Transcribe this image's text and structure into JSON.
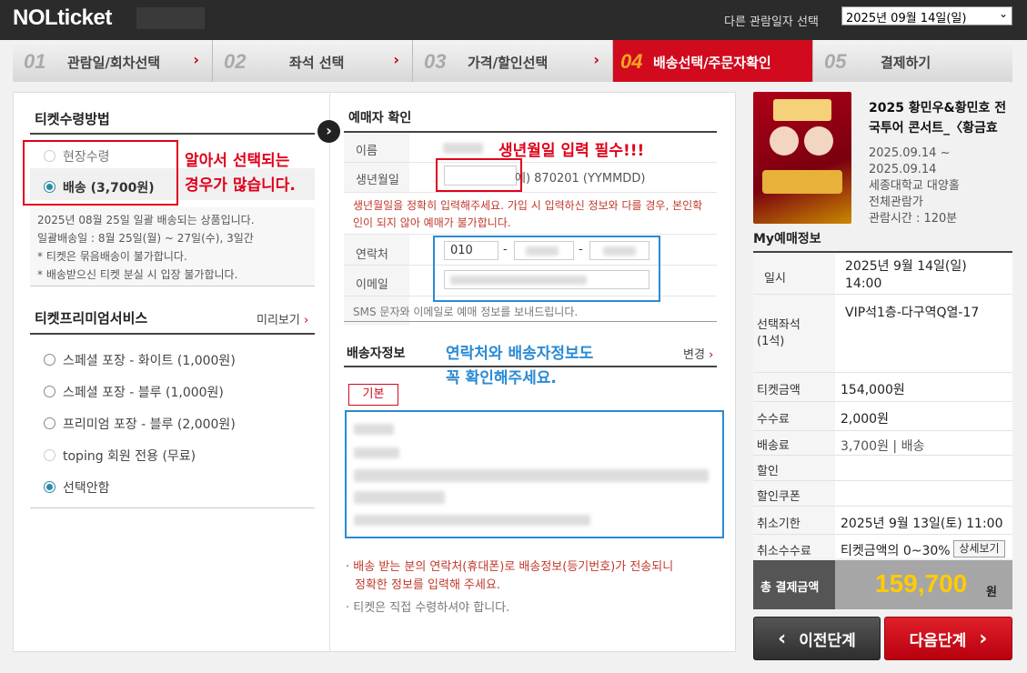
{
  "header": {
    "logo_bold": "NOL",
    "logo_rest": "ticket",
    "date_label": "다른 관람일자 선택",
    "date_value": "2025년 09월 14일(일)"
  },
  "steps": [
    {
      "num": "01",
      "label": "관람일/회차선택"
    },
    {
      "num": "02",
      "label": "좌석 선택"
    },
    {
      "num": "03",
      "label": "가격/할인선택"
    },
    {
      "num": "04",
      "label": "배송선택/주문자확인"
    },
    {
      "num": "05",
      "label": "결제하기"
    }
  ],
  "receive": {
    "title": "티켓수령방법",
    "opt1": "현장수령",
    "opt2": "배송 (3,700원)",
    "note_red": "2025년 08월 25일 일괄 배송되는 상품입니다.",
    "note1": "일괄배송일 : 8월 25일(월) ~ 27일(수), 3일간",
    "note2": "* 티켓은 묶음배송이 불가합니다.",
    "note3": "* 배송받으신 티켓 분실 시 입장 불가합니다.",
    "annotation_l1": "알아서 선택되는",
    "annotation_l2": "경우가 많습니다."
  },
  "premium": {
    "title": "티켓프리미엄서비스",
    "preview": "미리보기",
    "options": [
      "스페셜 포장 - 화이트 (1,000원)",
      "스페셜 포장 - 블루 (1,000원)",
      "프리미엄 포장 - 블루 (2,000원)",
      "toping 회원 전용 (무료)",
      "선택안함"
    ]
  },
  "booker": {
    "title": "예매자 확인",
    "name_label": "이름",
    "birth_label": "생년월일",
    "birth_hint": "예) 870201 (YYMMDD)",
    "birth_warning": "생년월일을 정확히 입력해주세요. 가입 시 입력하신 정보와 다를 경우, 본인확인이 되지 않아 예매가 불가합니다.",
    "birth_warning_l1": "생년월일을 정확히 입력해주세요. 가입 시 입력하신 정보와 다를 경우, 본인확",
    "birth_warning_l2": "인이 되지 않아 예매가 불가합니다.",
    "phone_label": "연락처",
    "phone_first": "010",
    "email_label": "이메일",
    "sms_note": "SMS 문자와 이메일로 예매 정보를 보내드립니다.",
    "annotation": "생년월일 입력 필수!!!"
  },
  "delivery": {
    "title": "배송자정보",
    "change": "변경",
    "default_tag": "기본",
    "annotation_l1": "연락처와 배송자정보도",
    "annotation_l2": "꼭 확인해주세요.",
    "note1_l1": "· 배송 받는 분의 연락처(휴대폰)로 배송정보(등기번호)가 전송되니",
    "note1_l2": "정확한 정보를 입력해 주세요.",
    "note2": "· 티켓은 직접 수령하셔야 합니다."
  },
  "show": {
    "title": "2025 황민우&황민호 전국투어 콘서트_〈황금효",
    "title_l1": "2025 황민우&황민호 전",
    "title_l2": "국투어 콘서트_〈황금효",
    "dates_l1": "2025.09.14 ~",
    "dates_l2": "2025.09.14",
    "venue": "세종대학교 대양홀",
    "rating": "전체관람가",
    "runtime": "관람시간 : 120분"
  },
  "my": {
    "title": "My예매정보",
    "date_label": "일시",
    "date_value": "2025년 9월 14일(일) 14:00",
    "date_l1": "2025년 9월 14일(일)",
    "date_l2": "14:00",
    "seat_label_l1": "선택좌석",
    "seat_label_l2": "(1석)",
    "seat_value": "VIP석1층-다구역Q열-17",
    "ticket_label": "티켓금액",
    "ticket_value": "154,000원",
    "fee_label": "수수료",
    "fee_value": "2,000원",
    "ship_label": "배송료",
    "ship_value": "3,700원 | 배송",
    "discount_label": "할인",
    "coupon_label": "할인쿠폰",
    "cancel_deadline_label": "취소기한",
    "cancel_deadline_value": "2025년 9월 13일(토) 11:00",
    "cancel_fee_label": "취소수수료",
    "cancel_fee_value": "티켓금액의 0~30%",
    "detail_btn": "상세보기",
    "total_label": "총 결제금액",
    "total_value": "159,700",
    "total_unit": "원"
  },
  "buttons": {
    "prev": "이전단계",
    "next": "다음단계"
  },
  "colors": {
    "accent_red": "#d10a1e",
    "annotation_red": "#e0001b",
    "annotation_blue": "#2a8ad4",
    "total_yellow": "#ffcc00"
  }
}
